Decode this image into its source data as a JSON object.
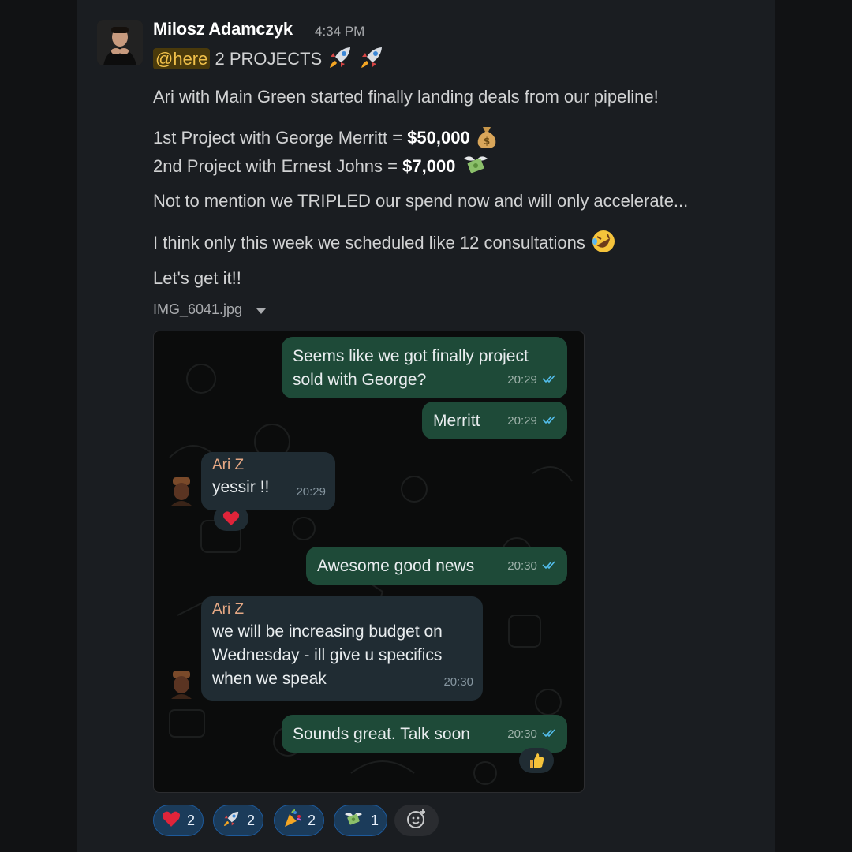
{
  "message": {
    "author": "Milosz Adamczyk",
    "time": "4:34 PM",
    "mention": "@here",
    "headline": "2 PROJECTS",
    "line1": "Ari with Main Green started finally landing deals from our pipeline!",
    "project1_prefix": "1st Project with George Merritt = ",
    "project1_amount": "$50,000",
    "project2_prefix": "2nd Project with Ernest Johns = ",
    "project2_amount": "$7,000",
    "line3": "Not to mention we TRIPLED our spend now and will only accelerate...",
    "line4": "I think only this week we scheduled like 12 consultations",
    "line5": "Let's get it!!",
    "attachment": "IMG_6041.jpg"
  },
  "chat": {
    "m1_line1": "Seems like we got finally project",
    "m1_line2": "sold with George?",
    "m1_time": "20:29",
    "m2": "Merritt",
    "m2_time": "20:29",
    "m3_sender": "Ari Z",
    "m3": "yessir !!",
    "m3_time": "20:29",
    "m4": "Awesome good news",
    "m4_time": "20:30",
    "m5_sender": "Ari Z",
    "m5_line1": "we will be increasing budget on",
    "m5_line2": "Wednesday - ill give u specifics",
    "m5_line3": "when we speak",
    "m5_time": "20:30",
    "m6": "Sounds great. Talk soon",
    "m6_time": "20:30"
  },
  "reactions": [
    {
      "icon": "heart-icon",
      "count": "2"
    },
    {
      "icon": "rocket-icon",
      "count": "2"
    },
    {
      "icon": "party-popper-icon",
      "count": "2"
    },
    {
      "icon": "money-with-wings-icon",
      "count": "1"
    }
  ],
  "colors": {
    "mention_bg": "#4a3a0b",
    "outgoing_bubble": "#1e4a38",
    "incoming_bubble": "#202c33",
    "reaction_pill": "#1b3b5a"
  }
}
